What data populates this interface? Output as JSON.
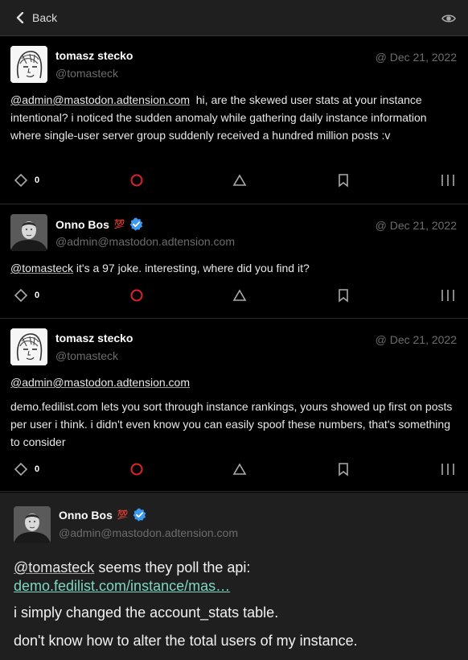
{
  "header": {
    "back_label": "Back"
  },
  "posts": [
    {
      "display_name": "tomasz stecko",
      "handle": "@tomasteck",
      "timestamp": "@ Dec 21, 2022",
      "mention": "@admin@mastodon.adtension.com",
      "text": "hi, are the skewed user stats at your instance intentional? i noticed the sudden anomaly while gathering daily instance information where single-user server group suddenly received a hundred million posts :v",
      "reply_count": "0"
    },
    {
      "display_name": "Onno Bos",
      "badge": "💯",
      "handle": "@admin@mastodon.adtension.com",
      "timestamp": "@ Dec 21, 2022",
      "mention": "@tomasteck",
      "text": "it's a 97 joke. interesting, where did you find it?",
      "reply_count": "0"
    },
    {
      "display_name": "tomasz stecko",
      "handle": "@tomasteck",
      "timestamp": "@ Dec 21, 2022",
      "mention": "@admin@mastodon.adtension.com",
      "text": "demo.fedilist.com lets you sort through instance rankings, yours showed up first on posts per user i think. i didn't even know you can easily spoof these numbers, that's something to consider",
      "reply_count": "0"
    }
  ],
  "focused": {
    "display_name": "Onno Bos",
    "badge": "💯",
    "handle": "@admin@mastodon.adtension.com",
    "mention": "@tomasteck",
    "line1_text": "seems they poll the api:",
    "link": "demo.fedilist.com/instance/mas…",
    "line2": "i simply changed the account_stats table.",
    "line3": "don't know how to alter the total users of my instance."
  },
  "colors": {
    "background": "#000000",
    "topbar": "#1f1f1f",
    "boost_accent": "#e0232b",
    "verified": "#3b99f0",
    "link": "#7fd6c2"
  }
}
